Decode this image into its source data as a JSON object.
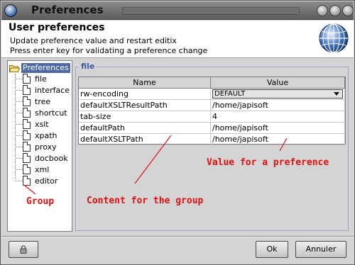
{
  "window": {
    "title": "Preferences"
  },
  "window_buttons": {
    "minimize": "●",
    "maximize": "●",
    "close": "●"
  },
  "header": {
    "title": "User preferences",
    "line1": "Update preference value and restart editix",
    "line2": "Press enter key for validating a preference change"
  },
  "tree": {
    "root": "Preferences",
    "items": [
      "file",
      "interface",
      "tree",
      "shortcut",
      "xslt",
      "xpath",
      "proxy",
      "docbook",
      "xml",
      "editor"
    ]
  },
  "group": {
    "title": "file"
  },
  "table": {
    "headers": {
      "name": "Name",
      "value": "Value"
    },
    "rows": [
      {
        "name": "rw-encoding",
        "value": "DEFAULT"
      },
      {
        "name": "defaultXSLTResultPath",
        "value": "/home/japisoft"
      },
      {
        "name": "tab-size",
        "value": "4"
      },
      {
        "name": "defaultPath",
        "value": "/home/japisoft"
      },
      {
        "name": "defaultXSLTPath",
        "value": "/home/japisoft"
      }
    ]
  },
  "annotations": {
    "value": "Value for a preference",
    "content": "Content for the group",
    "group": "Group"
  },
  "buttons": {
    "ok": "Ok",
    "cancel": "Annuler"
  },
  "colors": {
    "annotation": "#e01010",
    "selection": "#4f6aa3",
    "group_title": "#3a5aa8"
  }
}
